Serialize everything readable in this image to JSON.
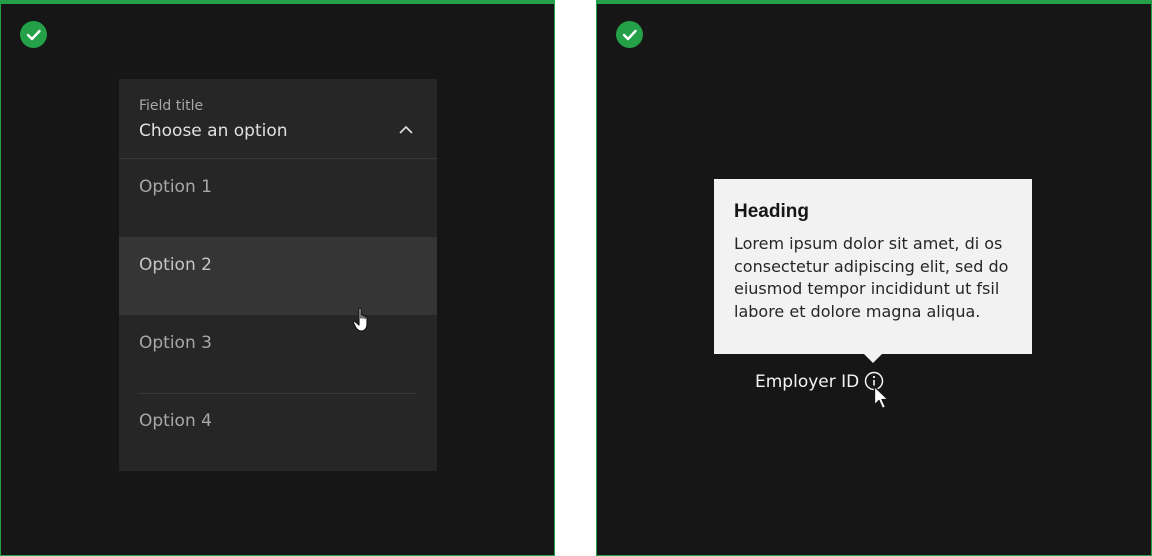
{
  "dropdown": {
    "field_title": "Field title",
    "value": "Choose an option",
    "options": [
      "Option 1",
      "Option 2",
      "Option 3",
      "Option 4"
    ],
    "hovered_option": "Option 2"
  },
  "tooltip": {
    "heading": "Heading",
    "body": "Lorem ipsum dolor sit amet, di os consectetur adipiscing elit, sed do eiusmod tempor incididunt ut fsil labore et dolore magna aliqua."
  },
  "field": {
    "label": "Employer ID"
  },
  "icons": {
    "status": "checkmark-icon",
    "chevron": "chevron-up-icon",
    "info": "information-icon",
    "hover_cursor": "hand-pointer-cursor",
    "arrow_cursor": "arrow-pointer-cursor"
  },
  "colors": {
    "success_green": "#24a148",
    "panel_background": "#161616",
    "field_background": "#262626",
    "hover_background": "#353535",
    "tooltip_background": "#f2f2f2"
  }
}
